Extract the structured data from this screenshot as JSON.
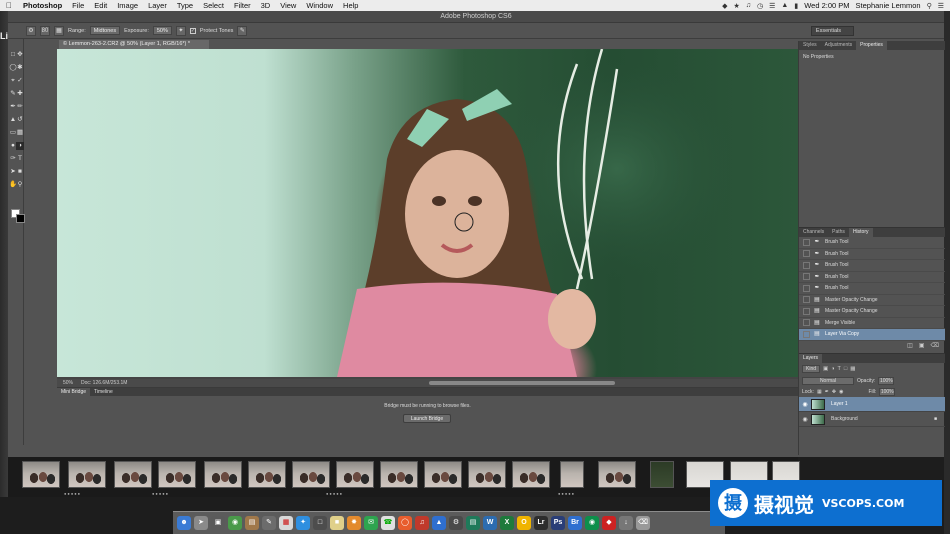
{
  "menubar": {
    "app_name": "Photoshop",
    "items": [
      "File",
      "Edit",
      "Image",
      "Layer",
      "Type",
      "Select",
      "Filter",
      "3D",
      "View",
      "Window",
      "Help"
    ],
    "clock": "Wed 2:00 PM",
    "user": "Stephanie Lemmon"
  },
  "window": {
    "title": "Adobe Photoshop CS6"
  },
  "options": {
    "brush_size": "80",
    "range_label": "Range:",
    "range_value": "Midtones",
    "exposure_label": "Exposure:",
    "exposure_value": "50%",
    "protect_tones": "Protect Tones",
    "workspace": "Essentials"
  },
  "document": {
    "tab_title": "© Lemmon-263-2.CR2 @ 50% (Layer 1, RGB/16*) *",
    "zoom": "50%",
    "doc_size": "Doc: 126.6M/253.1M"
  },
  "bridge": {
    "tabs": [
      "Mini Bridge",
      "Timeline"
    ],
    "message": "Bridge must be running to browse files.",
    "button": "Launch Bridge"
  },
  "properties": {
    "tabs": [
      "Styles",
      "Adjustments",
      "Properties"
    ],
    "empty": "No Properties"
  },
  "history": {
    "tabs": [
      "Channels",
      "Paths",
      "History"
    ],
    "items": [
      {
        "label": "Brush Tool",
        "icon": "brush"
      },
      {
        "label": "Brush Tool",
        "icon": "brush"
      },
      {
        "label": "Brush Tool",
        "icon": "brush"
      },
      {
        "label": "Brush Tool",
        "icon": "brush"
      },
      {
        "label": "Brush Tool",
        "icon": "brush"
      },
      {
        "label": "Master Opacity Change",
        "icon": "doc"
      },
      {
        "label": "Master Opacity Change",
        "icon": "doc"
      },
      {
        "label": "Merge Visible",
        "icon": "doc"
      },
      {
        "label": "Layer Via Copy",
        "icon": "doc"
      }
    ]
  },
  "layers": {
    "title": "Layers",
    "kind": "Kind",
    "blend": "Normal",
    "opacity_label": "Opacity:",
    "opacity": "100%",
    "lock_label": "Lock:",
    "fill_label": "Fill:",
    "fill": "100%",
    "items": [
      {
        "name": "Layer 1",
        "selected": true
      },
      {
        "name": "Background",
        "selected": false
      }
    ]
  },
  "desktop": {
    "side_text": "Li"
  },
  "watermark": {
    "cn": "摄视觉",
    "en": "VSCOPS.COM",
    "logo": "摄"
  }
}
